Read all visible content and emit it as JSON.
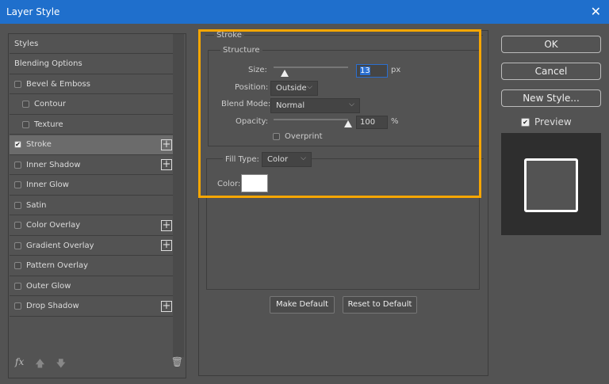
{
  "window": {
    "title": "Layer Style",
    "close": "✕"
  },
  "sidebar": {
    "items": [
      {
        "label": "Styles",
        "checkbox": false
      },
      {
        "label": "Blending Options",
        "checkbox": false
      },
      {
        "label": "Bevel & Emboss",
        "checkbox": true,
        "checked": false
      },
      {
        "label": "Contour",
        "checkbox": true,
        "checked": false,
        "indent": true
      },
      {
        "label": "Texture",
        "checkbox": true,
        "checked": false,
        "indent": true
      },
      {
        "label": "Stroke",
        "checkbox": true,
        "checked": true,
        "plus": true,
        "selected": true
      },
      {
        "label": "Inner Shadow",
        "checkbox": true,
        "checked": false,
        "plus": true
      },
      {
        "label": "Inner Glow",
        "checkbox": true,
        "checked": false
      },
      {
        "label": "Satin",
        "checkbox": true,
        "checked": false
      },
      {
        "label": "Color Overlay",
        "checkbox": true,
        "checked": false,
        "plus": true
      },
      {
        "label": "Gradient Overlay",
        "checkbox": true,
        "checked": false,
        "plus": true
      },
      {
        "label": "Pattern Overlay",
        "checkbox": true,
        "checked": false
      },
      {
        "label": "Outer Glow",
        "checkbox": true,
        "checked": false
      },
      {
        "label": "Drop Shadow",
        "checkbox": true,
        "checked": false,
        "plus": true
      }
    ],
    "fx": "fx",
    "up": "🡅",
    "down": "🡇",
    "trash": "🗑"
  },
  "stroke": {
    "title": "Stroke",
    "structure": "Structure",
    "size_label": "Size:",
    "size_value": "13",
    "size_unit": "px",
    "size_fraction": 0.04,
    "position_label": "Position:",
    "position_value": "Outside",
    "blend_label": "Blend Mode:",
    "blend_value": "Normal",
    "opacity_label": "Opacity:",
    "opacity_value": "100",
    "opacity_unit": "%",
    "opacity_fraction": 1.0,
    "overprint": "Overprint",
    "fill_type_label": "Fill Type:",
    "fill_type_value": "Color",
    "color_label": "Color:",
    "color_value": "#ffffff"
  },
  "buttons": {
    "make_default": "Make Default",
    "reset_default": "Reset to Default",
    "ok": "OK",
    "cancel": "Cancel",
    "new_style": "New Style...",
    "preview": "Preview"
  },
  "colors": {
    "highlight": "#f7a600",
    "titlebar": "#1f6fcc"
  }
}
